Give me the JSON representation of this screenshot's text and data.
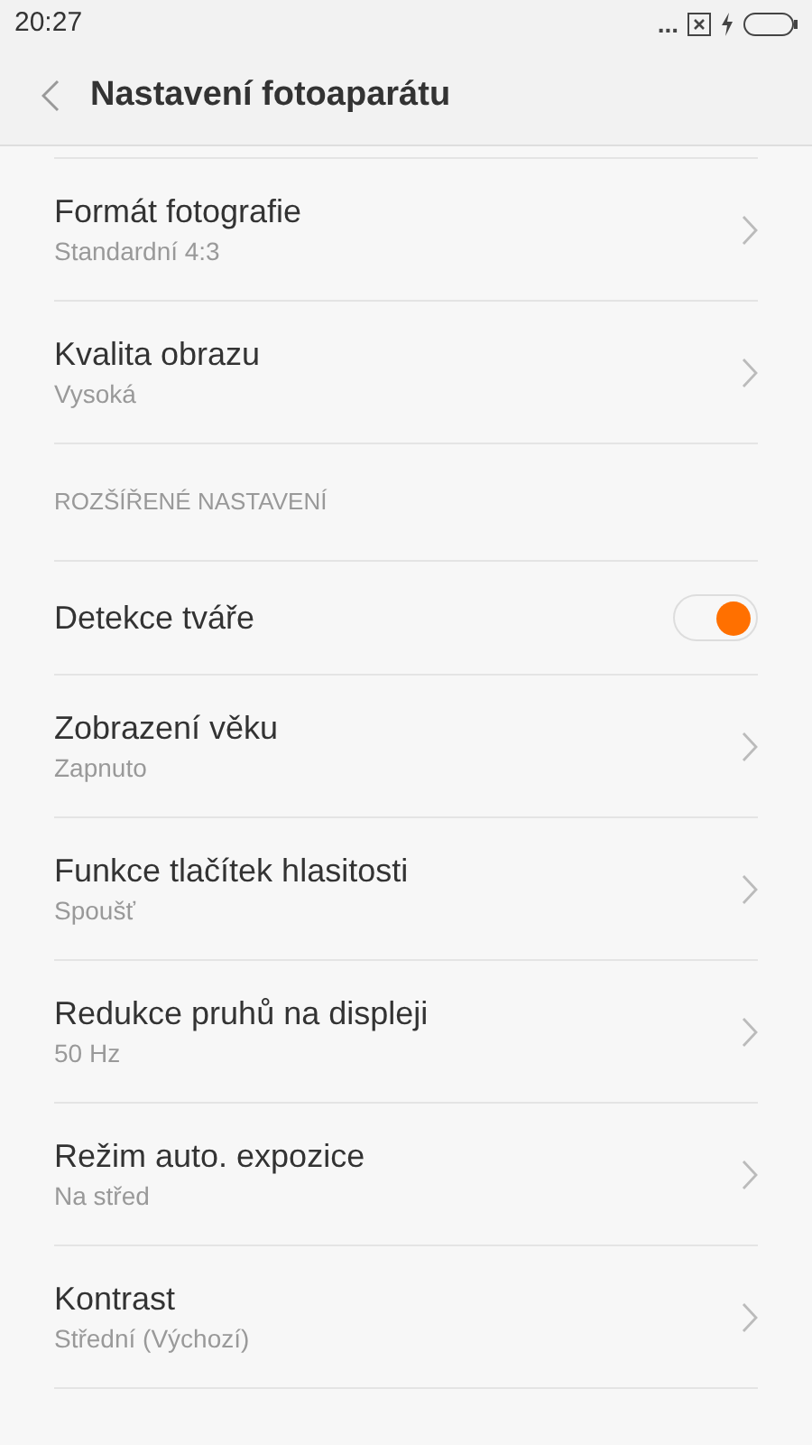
{
  "status_bar": {
    "time": "20:27",
    "dots": "..."
  },
  "header": {
    "title": "Nastavení fotoaparátu"
  },
  "items": [
    {
      "kind": "nav",
      "title": "Formát fotografie",
      "value": "Standardní 4:3"
    },
    {
      "kind": "nav",
      "title": "Kvalita obrazu",
      "value": "Vysoká"
    },
    {
      "kind": "section",
      "title": "ROZŠÍŘENÉ NASTAVENÍ"
    },
    {
      "kind": "toggle",
      "title": "Detekce tváře",
      "on": true
    },
    {
      "kind": "nav",
      "title": "Zobrazení věku",
      "value": "Zapnuto"
    },
    {
      "kind": "nav",
      "title": "Funkce tlačítek hlasitosti",
      "value": "Spoušť"
    },
    {
      "kind": "nav",
      "title": "Redukce pruhů na displeji",
      "value": "50 Hz"
    },
    {
      "kind": "nav",
      "title": "Režim auto. expozice",
      "value": "Na střed"
    },
    {
      "kind": "nav",
      "title": "Kontrast",
      "value": "Střední (Výchozí)"
    }
  ]
}
